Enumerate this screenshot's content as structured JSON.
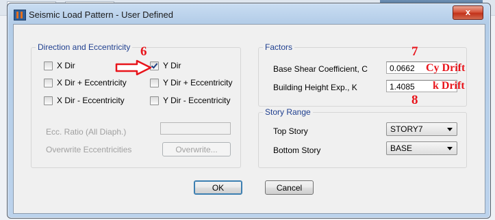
{
  "dialog": {
    "title": "Seismic Load Pattern - User Defined",
    "close_label": "x"
  },
  "direction": {
    "legend": "Direction and Eccentricity",
    "options": [
      {
        "label": "X Dir",
        "checked": false
      },
      {
        "label": "X Dir + Eccentricity",
        "checked": false
      },
      {
        "label": "X Dir - Eccentricity",
        "checked": false
      },
      {
        "label": "Y Dir",
        "checked": true
      },
      {
        "label": "Y Dir + Eccentricity",
        "checked": false
      },
      {
        "label": "Y Dir - Eccentricity",
        "checked": false
      }
    ],
    "ecc_ratio_label": "Ecc. Ratio (All Diaph.)",
    "ecc_ratio_value": "",
    "overwrite_label": "Overwrite Eccentricities",
    "overwrite_button": "Overwrite..."
  },
  "factors": {
    "legend": "Factors",
    "base_shear_label": "Base Shear Coefficient, C",
    "base_shear_value": "0.0662",
    "height_exp_label": "Building Height Exp., K",
    "height_exp_value": "1.4085"
  },
  "story_range": {
    "legend": "Story Range",
    "top_label": "Top Story",
    "top_value": "STORY7",
    "bottom_label": "Bottom Story",
    "bottom_value": "BASE"
  },
  "buttons": {
    "ok": "OK",
    "cancel": "Cancel"
  },
  "annotations": {
    "num6": "6",
    "num7": "7",
    "num8": "8",
    "cy_drift": "Cy Drift",
    "k_drift": "k Drift",
    "color": "#e8141b"
  }
}
